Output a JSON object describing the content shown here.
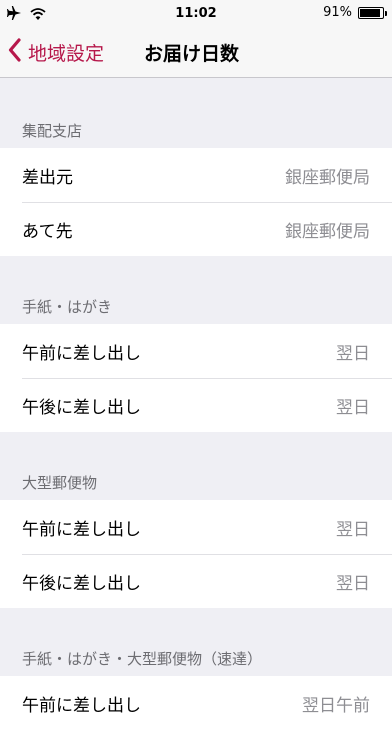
{
  "status_bar": {
    "time": "11:02",
    "battery_percent_text": "91%",
    "battery_level": 0.91,
    "icons": [
      "airplane-icon",
      "wifi-icon",
      "battery-icon"
    ]
  },
  "nav": {
    "back_label": "地域設定",
    "title": "お届け日数",
    "accent_color": "#b6184b"
  },
  "sections": [
    {
      "header": "集配支店",
      "rows": [
        {
          "label": "差出元",
          "value": "銀座郵便局"
        },
        {
          "label": "あて先",
          "value": "銀座郵便局"
        }
      ]
    },
    {
      "header": "手紙・はがき",
      "rows": [
        {
          "label": "午前に差し出し",
          "value": "翌日"
        },
        {
          "label": "午後に差し出し",
          "value": "翌日"
        }
      ]
    },
    {
      "header": "大型郵便物",
      "rows": [
        {
          "label": "午前に差し出し",
          "value": "翌日"
        },
        {
          "label": "午後に差し出し",
          "value": "翌日"
        }
      ]
    },
    {
      "header": "手紙・はがき・大型郵便物（速達）",
      "rows": [
        {
          "label": "午前に差し出し",
          "value": "翌日午前"
        }
      ]
    }
  ]
}
